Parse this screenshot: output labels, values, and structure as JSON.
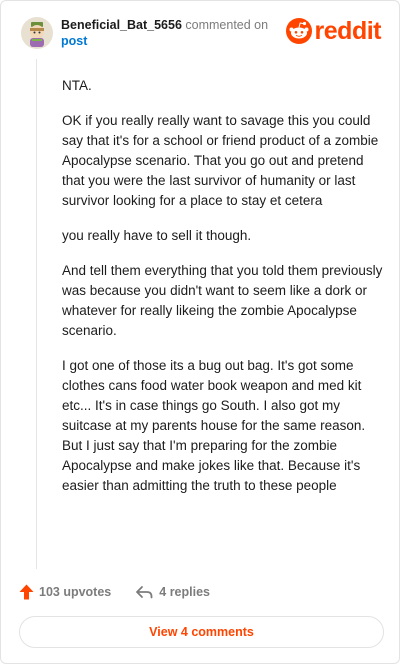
{
  "header": {
    "username": "Beneficial_Bat_5656",
    "action_text": "commented on",
    "post_link": "post",
    "logo_text": "reddit"
  },
  "comment": {
    "paragraphs": [
      "NTA.",
      "OK if you really really want to savage this you could say that it's for a school or friend product of a zombie Apocalypse scenario. That you go out and pretend that you were the last survivor of humanity or last survivor looking for a place to stay et cetera",
      "you really have to sell it though.",
      "And tell them everything that you told them previously was because you didn't want to seem like a dork or whatever for really likeing the zombie Apocalypse scenario.",
      "I got one of those its a bug out bag. It's got some clothes cans food water book weapon and med kit etc... It's in case things go South. I also got my suitcase at my parents house for the same reason. But I just say that I'm preparing for the zombie Apocalypse and make jokes like that. Because it's easier than admitting the truth to these people"
    ]
  },
  "footer": {
    "upvotes_label": "103 upvotes",
    "replies_label": "4 replies",
    "view_comments_label": "View 4 comments"
  },
  "colors": {
    "brand": "#ff4500",
    "link": "#0079d3",
    "muted": "#7c7c7c"
  },
  "icons": {
    "avatar": "snoo-avatar",
    "logo": "reddit-logo-icon",
    "upvote": "upvote-arrow-icon",
    "reply": "reply-arrow-icon"
  }
}
